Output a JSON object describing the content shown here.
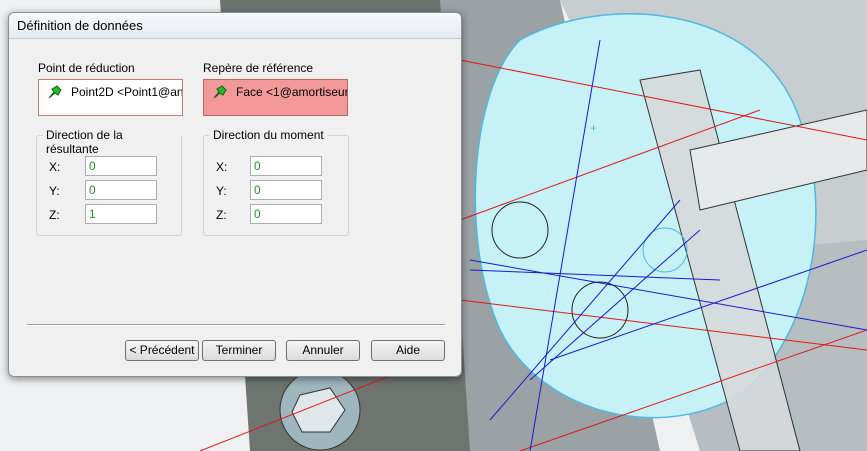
{
  "dialog": {
    "title": "Définition de données",
    "reduction_point": {
      "label": "Point de réduction",
      "value": "Point2D <Point1@an...",
      "icon": "green-pin-icon"
    },
    "reference_frame": {
      "label": "Repère de référence",
      "value": "Face <1@amortiseur ...",
      "icon": "green-pin-icon"
    },
    "resultant_direction": {
      "title": "Direction de la résultante",
      "x_label": "X:",
      "x": "0",
      "y_label": "Y:",
      "y": "0",
      "z_label": "Z:",
      "z": "1"
    },
    "moment_direction": {
      "title": "Direction du moment",
      "x_label": "X:",
      "x": "0",
      "y_label": "Y:",
      "y": "0",
      "z_label": "Z:",
      "z": "0"
    },
    "buttons": {
      "previous": "< Précédent",
      "finish": "Terminer",
      "cancel": "Annuler",
      "help": "Aide"
    }
  },
  "colors": {
    "reference_highlight": "#f39999",
    "value_text": "#2e8b2e",
    "model_face": "#bfeff5",
    "wire_red": "#e01818",
    "wire_blue": "#1a1acc"
  }
}
